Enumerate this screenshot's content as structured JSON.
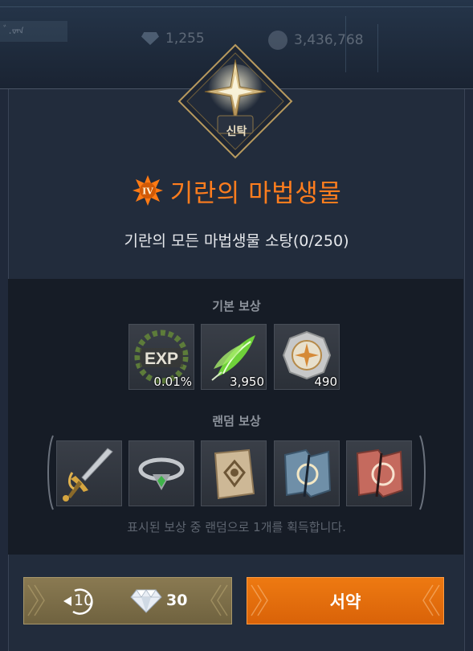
{
  "hud": {
    "tag": "ﾞ.ᢦᠬ",
    "diamonds": "1,255",
    "gold": "3,436,768"
  },
  "emblem": {
    "label": "신탁",
    "rank_numeral": "IV"
  },
  "quest": {
    "title": "기란의 마법생물",
    "objective": "기란의 모든 마법생물 소탕(0/250)"
  },
  "rewards": {
    "basic_label": "기본 보상",
    "basic_items": [
      {
        "icon": "exp-laurel-icon",
        "qty": "0.01%"
      },
      {
        "icon": "green-feather-icon",
        "qty": "3,950"
      },
      {
        "icon": "silver-medal-icon",
        "qty": "490"
      }
    ],
    "random_label": "랜덤 보상",
    "random_items": [
      {
        "icon": "golden-sword-icon"
      },
      {
        "icon": "emerald-ring-icon"
      },
      {
        "icon": "scroll-icon"
      },
      {
        "icon": "blue-torn-scroll-icon"
      },
      {
        "icon": "red-torn-scroll-icon"
      }
    ],
    "note": "표시된 보상 중 랜덤으로 1개를 획득합니다."
  },
  "buttons": {
    "refresh_count": "10",
    "diamond_cost": "30",
    "accept_label": "서약"
  },
  "colors": {
    "title": "#ff7d1e",
    "accept": "#e66f0d",
    "refresh": "#7c6d48"
  }
}
